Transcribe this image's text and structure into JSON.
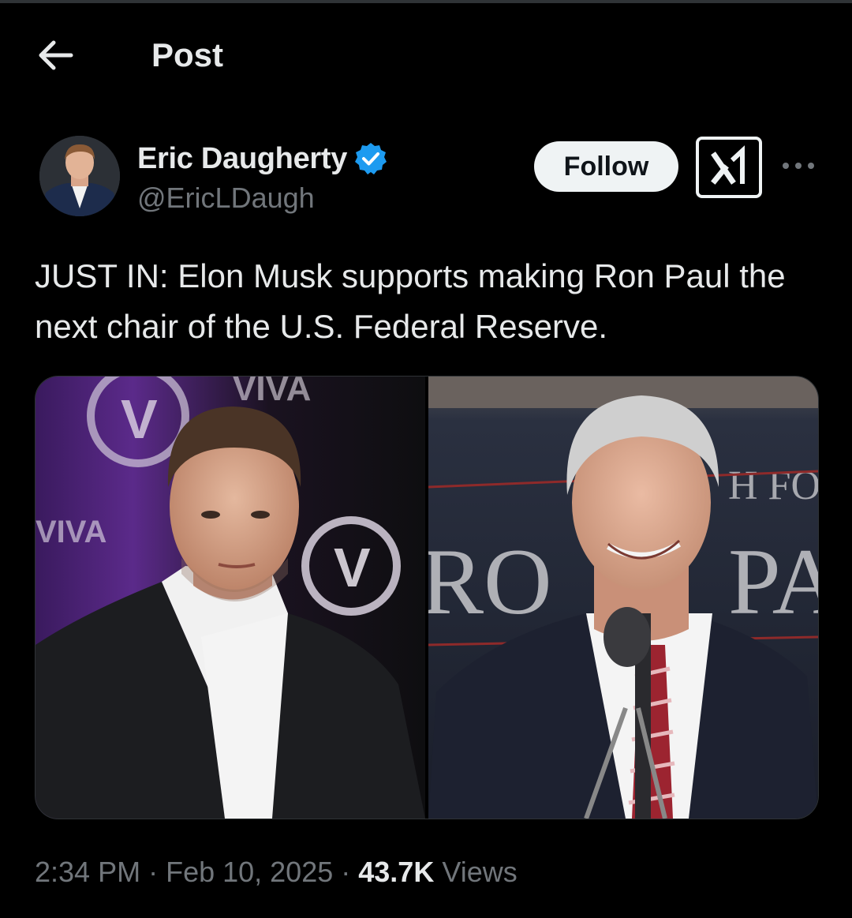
{
  "header": {
    "title": "Post"
  },
  "author": {
    "name": "Eric Daugherty",
    "handle": "@EricLDaugh",
    "verified": true
  },
  "actions": {
    "follow_label": "Follow",
    "grok_icon": "grok-icon",
    "more_icon": "more-icon"
  },
  "post": {
    "text": "JUST IN: Elon Musk supports making Ron Paul the next chair of the U.S. Federal Reserve."
  },
  "meta": {
    "time": "2:34 PM",
    "sep1": " · ",
    "date": "Feb 10, 2025",
    "sep2": " · ",
    "views_count": "43.7K",
    "views_label": " Views"
  },
  "colors": {
    "background": "#000000",
    "text": "#e7e9ea",
    "secondary": "#71767b",
    "verified": "#1d9bf0"
  }
}
